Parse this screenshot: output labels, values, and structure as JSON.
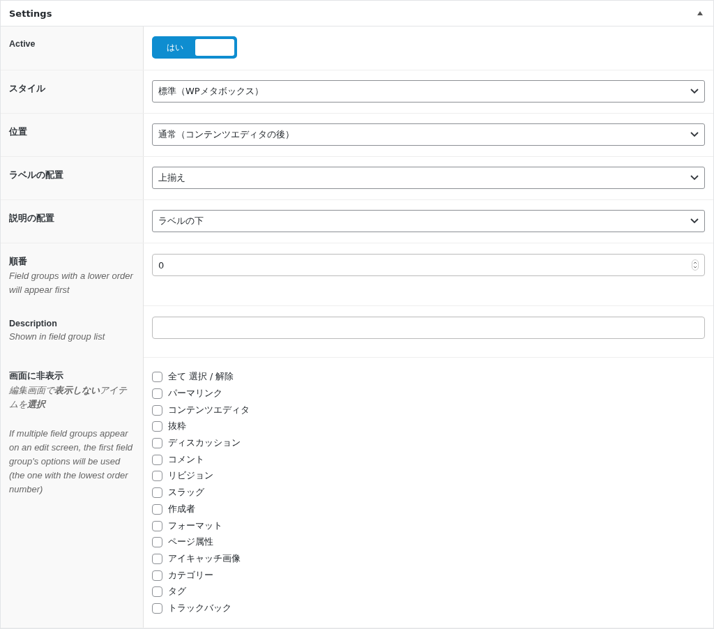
{
  "panel": {
    "title": "Settings",
    "expanded": true
  },
  "rows": [
    {
      "kind": "toggle",
      "label": "Active",
      "toggle": {
        "label": "はい",
        "on": true
      }
    },
    {
      "kind": "select",
      "label": "スタイル",
      "value": "標準（WPメタボックス）"
    },
    {
      "kind": "select",
      "label": "位置",
      "value": "通常（コンテンツエディタの後）"
    },
    {
      "kind": "select",
      "label": "ラベルの配置",
      "value": "上揃え"
    },
    {
      "kind": "select",
      "label": "説明の配置",
      "value": "ラベルの下"
    },
    {
      "kind": "number",
      "label": "順番",
      "help": [
        "Field groups with a lower order will appear first"
      ],
      "value": "0"
    },
    {
      "kind": "text",
      "label": "Description",
      "help": [
        "Shown in field group list"
      ]
    },
    {
      "kind": "checklist",
      "label": "画面に非表示",
      "help": [
        "編集画面で**表示しない**アイテムを**選択**",
        "If multiple field groups appear on an edit screen, the first field group's options will be used (the one with the lowest order number)"
      ],
      "options": [
        {
          "label": "全て 選択 / 解除",
          "checked": false
        },
        {
          "label": "パーマリンク",
          "checked": false
        },
        {
          "label": "コンテンツエディタ",
          "checked": false
        },
        {
          "label": "抜粋",
          "checked": false
        },
        {
          "label": "ディスカッション",
          "checked": false
        },
        {
          "label": "コメント",
          "checked": false
        },
        {
          "label": "リビジョン",
          "checked": false
        },
        {
          "label": "スラッグ",
          "checked": false
        },
        {
          "label": "作成者",
          "checked": false
        },
        {
          "label": "フォーマット",
          "checked": false
        },
        {
          "label": "ページ属性",
          "checked": false
        },
        {
          "label": "アイキャッチ画像",
          "checked": false
        },
        {
          "label": "カテゴリー",
          "checked": false
        },
        {
          "label": "タグ",
          "checked": false
        },
        {
          "label": "トラックバック",
          "checked": false
        }
      ]
    }
  ]
}
